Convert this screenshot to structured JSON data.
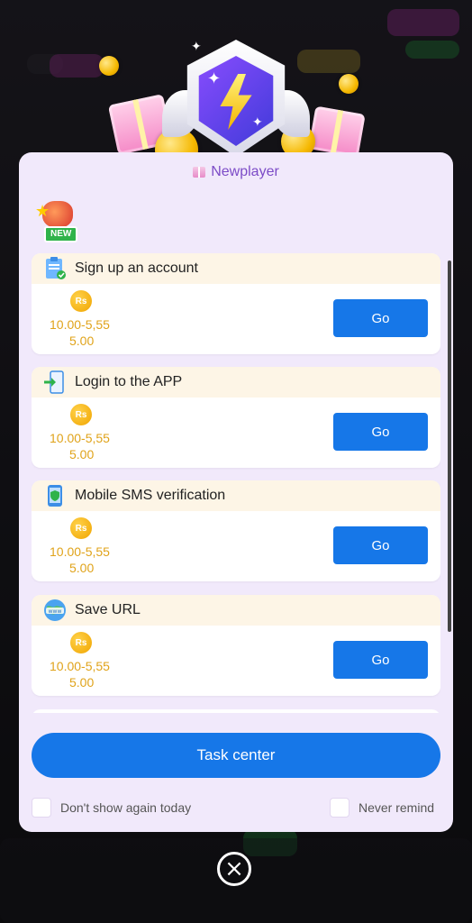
{
  "modal": {
    "title": "Newplayer",
    "new_tag": "NEW"
  },
  "tasks": [
    {
      "name": "Sign up an account",
      "icon": "clipboard-check-icon",
      "coin": "Rs",
      "range": "10.00-5,55",
      "amount": "5.00",
      "button": "Go"
    },
    {
      "name": "Login to the APP",
      "icon": "phone-login-icon",
      "coin": "Rs",
      "range": "10.00-5,55",
      "amount": "5.00",
      "button": "Go"
    },
    {
      "name": "Mobile SMS verification",
      "icon": "phone-shield-icon",
      "coin": "Rs",
      "range": "10.00-5,55",
      "amount": "5.00",
      "button": "Go"
    },
    {
      "name": "Save URL",
      "icon": "globe-www-icon",
      "coin": "Rs",
      "range": "10.00-5,55",
      "amount": "5.00",
      "button": "Go"
    }
  ],
  "actions": {
    "task_center": "Task center",
    "dont_show_today": "Don't show again today",
    "never_remind": "Never remind"
  },
  "colors": {
    "accent": "#1677e8",
    "reward": "#e0a31a",
    "title": "#7c4bc7",
    "modal_bg": "#f1e9fb"
  }
}
